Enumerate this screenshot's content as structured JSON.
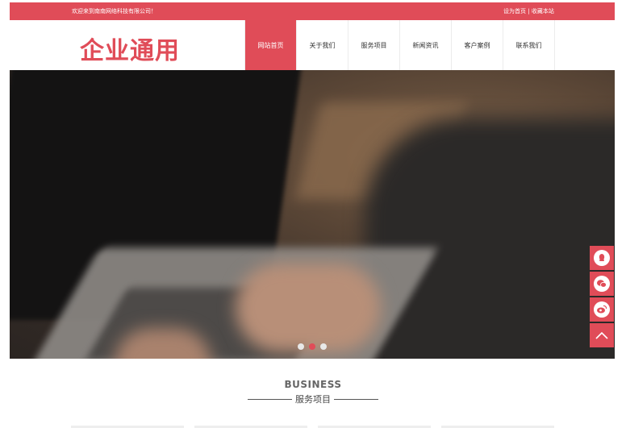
{
  "topbar": {
    "welcome": "欢迎来到南南网络科技有限公司！",
    "set_home": "设为首页",
    "separator": "|",
    "bookmark": "收藏本站"
  },
  "header": {
    "logo_text": "企业通用"
  },
  "nav": {
    "items": [
      {
        "label": "网站首页",
        "active": true
      },
      {
        "label": "关于我们",
        "active": false
      },
      {
        "label": "服务项目",
        "active": false
      },
      {
        "label": "新闻资讯",
        "active": false
      },
      {
        "label": "客户案例",
        "active": false
      },
      {
        "label": "联系我们",
        "active": false
      }
    ]
  },
  "banner": {
    "slide_count": 3,
    "active_slide": 2
  },
  "float_bar": {
    "icons": [
      "qq-icon",
      "wechat-icon",
      "weibo-icon",
      "back-to-top-icon"
    ]
  },
  "section": {
    "title_en": "BUSINESS",
    "title_cn": "服务项目"
  },
  "colors": {
    "accent": "#e04c58",
    "text": "#333333"
  }
}
